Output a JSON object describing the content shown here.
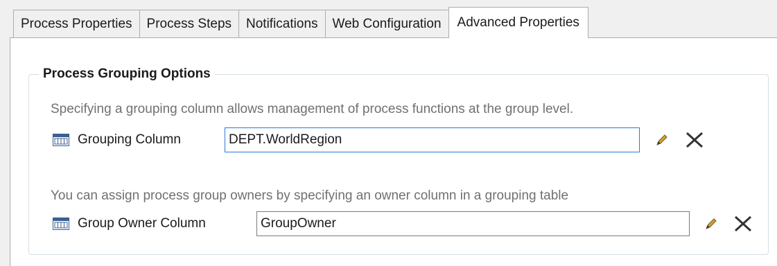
{
  "tabs": [
    {
      "label": "Process Properties",
      "active": false
    },
    {
      "label": "Process Steps",
      "active": false
    },
    {
      "label": "Notifications",
      "active": false
    },
    {
      "label": "Web Configuration",
      "active": false
    },
    {
      "label": "Advanced Properties",
      "active": true
    }
  ],
  "group": {
    "title": "Process Grouping Options",
    "grouping": {
      "description": "Specifying a grouping column allows management of process functions at the group level.",
      "label": "Grouping Column",
      "value": "DEPT.WorldRegion"
    },
    "owner": {
      "description": "You can assign process group owners by specifying an owner column in a grouping table",
      "label": "Group Owner Column",
      "value": "GroupOwner"
    }
  },
  "icons": {
    "column": "table-column-icon",
    "edit": "pencil-icon",
    "clear": "close-x-icon"
  },
  "colors": {
    "focus_border": "#2b7ad6",
    "pencil": "#d6a21e",
    "description_text": "#707070"
  }
}
